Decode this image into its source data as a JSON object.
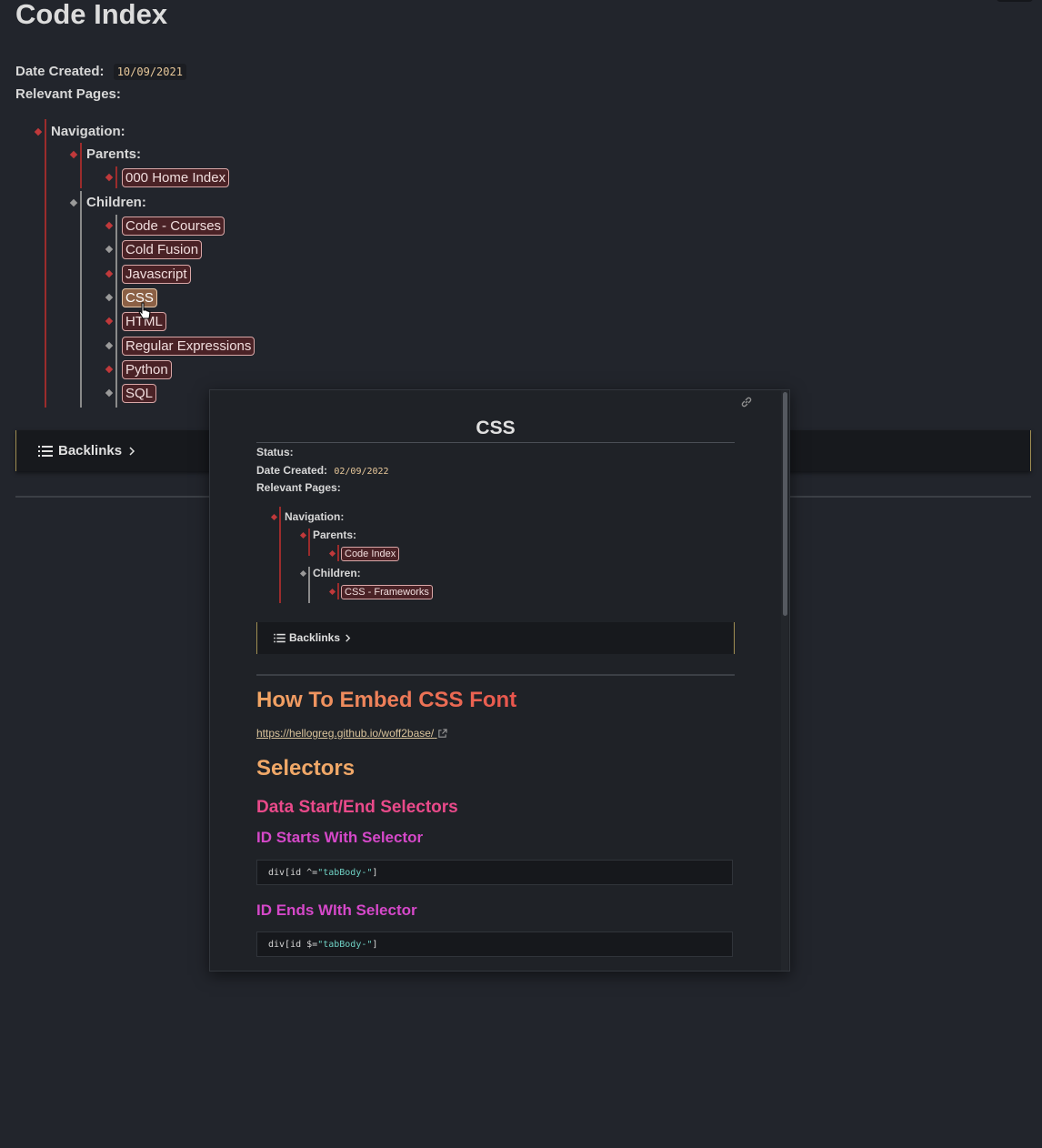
{
  "page": {
    "title": "Code Index",
    "date_created_label": "Date Created:",
    "date_created_value": "10/09/2021",
    "relevant_pages_label": "Relevant Pages:",
    "tree": {
      "navigation_label": "Navigation:",
      "parents_label": "Parents:",
      "parents": [
        "000 Home Index"
      ],
      "children_label": "Children:",
      "children": [
        "Code - Courses",
        "Cold Fusion",
        "Javascript",
        "CSS",
        "HTML",
        "Regular Expressions",
        "Python",
        "SQL"
      ]
    },
    "backlinks_label": "Backlinks"
  },
  "popover": {
    "title": "CSS",
    "status_label": "Status:",
    "date_created_label": "Date Created:",
    "date_created_value": "02/09/2022",
    "relevant_pages_label": "Relevant Pages:",
    "navigation_label": "Navigation:",
    "parents_label": "Parents:",
    "parents": [
      "Code Index"
    ],
    "children_label": "Children:",
    "children": [
      "CSS - Frameworks"
    ],
    "backlinks_label": "Backlinks",
    "heading_embed": "How To Embed CSS Font",
    "url": "https://hellogreg.github.io/woff2base/",
    "heading_selectors": "Selectors",
    "heading_data_selectors": "Data Start/End Selectors",
    "heading_id_starts": "ID Starts With Selector",
    "code_starts_prefix": "div[id ^=",
    "code_starts_string": "\"tabBody-\"",
    "code_starts_suffix": "]",
    "heading_id_ends": "ID Ends WIth Selector",
    "code_ends_prefix": "div[id $=",
    "code_ends_string": "\"tabBody-\"",
    "code_ends_suffix": "]"
  },
  "colors": {
    "background": "#22252c",
    "tag_bg": "#4a2226",
    "tag_border": "#d8a7a7",
    "accent_red": "#c0393b",
    "date_text": "#e8c89a"
  },
  "icons": [
    "list-icon",
    "chevron-right-icon",
    "link-icon",
    "external-link-icon",
    "pointer-cursor-icon"
  ]
}
